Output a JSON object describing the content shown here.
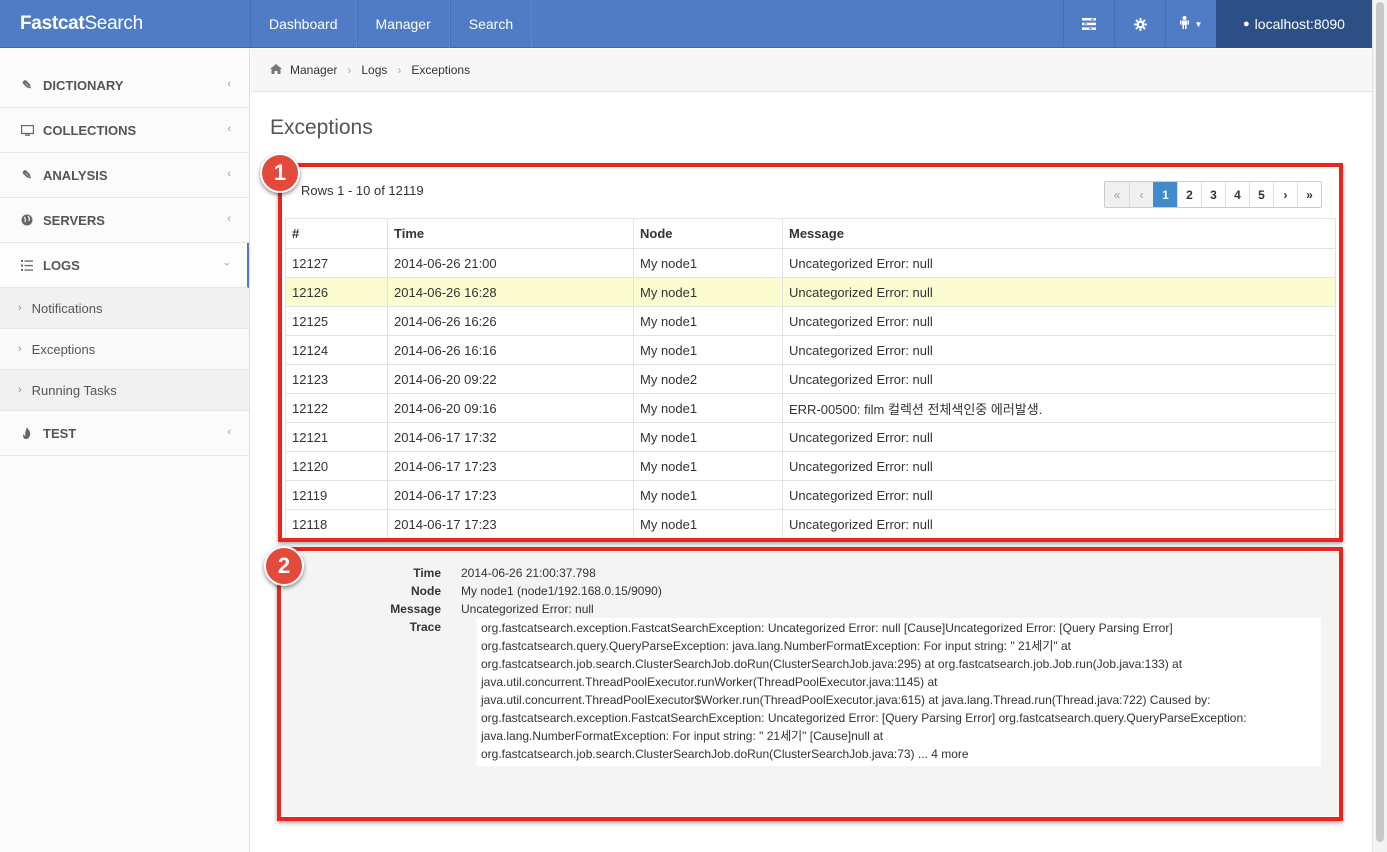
{
  "navbar": {
    "brand_bold": "Fastcat",
    "brand_rest": "Search",
    "menu": [
      "Dashboard",
      "Manager",
      "Search"
    ],
    "icons": [
      "list-icon",
      "gear-icon",
      "user-icon"
    ],
    "host": "localhost:8090"
  },
  "sidebar": {
    "items": [
      {
        "label": "DICTIONARY",
        "icon": "edit-icon"
      },
      {
        "label": "COLLECTIONS",
        "icon": "monitor-icon"
      },
      {
        "label": "ANALYSIS",
        "icon": "edit-icon"
      },
      {
        "label": "SERVERS",
        "icon": "globe-icon"
      },
      {
        "label": "LOGS",
        "icon": "list-icon"
      },
      {
        "label": "TEST",
        "icon": "fire-icon"
      }
    ],
    "logs_subitems": [
      "Notifications",
      "Exceptions",
      "Running Tasks"
    ]
  },
  "breadcrumb": [
    "Manager",
    "Logs",
    "Exceptions"
  ],
  "page_title": "Exceptions",
  "list": {
    "rows_info": "Rows 1 - 10 of 12119",
    "pager": [
      "«",
      "‹",
      "1",
      "2",
      "3",
      "4",
      "5",
      "›",
      "»"
    ],
    "current_page": "1",
    "columns": [
      "#",
      "Time",
      "Node",
      "Message"
    ],
    "rows": [
      [
        "12127",
        "2014-06-26 21:00",
        "My node1",
        "Uncategorized Error: null"
      ],
      [
        "12126",
        "2014-06-26 16:28",
        "My node1",
        "Uncategorized Error: null"
      ],
      [
        "12125",
        "2014-06-26 16:26",
        "My node1",
        "Uncategorized Error: null"
      ],
      [
        "12124",
        "2014-06-26 16:16",
        "My node1",
        "Uncategorized Error: null"
      ],
      [
        "12123",
        "2014-06-20 09:22",
        "My node2",
        "Uncategorized Error: null"
      ],
      [
        "12122",
        "2014-06-20 09:16",
        "My node1",
        "ERR-00500: film 컬렉션 전체색인중 에러발생."
      ],
      [
        "12121",
        "2014-06-17 17:32",
        "My node1",
        "Uncategorized Error: null"
      ],
      [
        "12120",
        "2014-06-17 17:23",
        "My node1",
        "Uncategorized Error: null"
      ],
      [
        "12119",
        "2014-06-17 17:23",
        "My node1",
        "Uncategorized Error: null"
      ],
      [
        "12118",
        "2014-06-17 17:23",
        "My node1",
        "Uncategorized Error: null"
      ]
    ],
    "highlighted_row": "12126"
  },
  "detail": {
    "time_label": "Time",
    "time": "2014-06-26 21:00:37.798",
    "node_label": "Node",
    "node": "My node1 (node1/192.168.0.15/9090)",
    "message_label": "Message",
    "message": "Uncategorized Error: null",
    "trace_label": "Trace",
    "trace_lines": [
      "org.fastcatsearch.exception.FastcatSearchException: Uncategorized Error: null [Cause]Uncategorized Error: [Query Parsing Error]",
      "org.fastcatsearch.query.QueryParseException: java.lang.NumberFormatException: For input string: \" 21세기\" at",
      "org.fastcatsearch.job.search.ClusterSearchJob.doRun(ClusterSearchJob.java:295) at org.fastcatsearch.job.Job.run(Job.java:133) at",
      "java.util.concurrent.ThreadPoolExecutor.runWorker(ThreadPoolExecutor.java:1145) at",
      "java.util.concurrent.ThreadPoolExecutor$Worker.run(ThreadPoolExecutor.java:615) at java.lang.Thread.run(Thread.java:722) Caused by:",
      "org.fastcatsearch.exception.FastcatSearchException: Uncategorized Error: [Query Parsing Error] org.fastcatsearch.query.QueryParseException:",
      "java.lang.NumberFormatException: For input string: \" 21세기\" [Cause]null at",
      "org.fastcatsearch.job.search.ClusterSearchJob.doRun(ClusterSearchJob.java:73) ... 4 more"
    ]
  },
  "annotations": {
    "badge1": "1",
    "badge2": "2",
    "box_color": "#e8261f"
  }
}
